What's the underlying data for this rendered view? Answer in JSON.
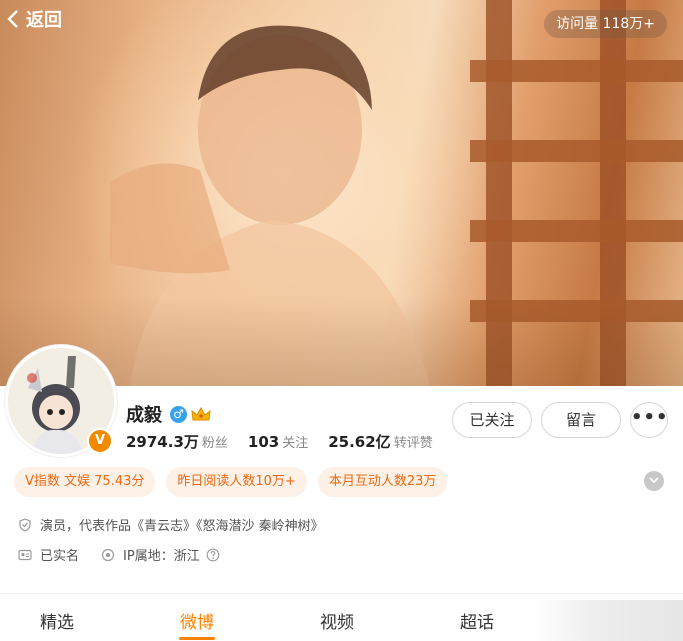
{
  "header": {
    "back_label": "返回",
    "visits": "访问量 118万+"
  },
  "profile": {
    "name": "成毅",
    "gender_symbol": "♂",
    "v_badge": "V",
    "stats": [
      {
        "value": "2974.3万",
        "label": "粉丝"
      },
      {
        "value": "103",
        "label": "关注"
      },
      {
        "value": "25.62亿",
        "label": "转评赞"
      }
    ]
  },
  "actions": {
    "follow_label": "已关注",
    "message_label": "留言",
    "more_label": "•••"
  },
  "tags": [
    "V指数 文娱 75.43分",
    "昨日阅读人数10万+",
    "本月互动人数23万"
  ],
  "info": {
    "bio": "演员，代表作品《青云志》《怒海潜沙 秦岭神树》",
    "verified": "已实名",
    "ip": "IP属地：浙江"
  },
  "tabs": [
    "精选",
    "微博",
    "视频",
    "超话"
  ],
  "colors": {
    "accent": "#ff8200",
    "tag_text": "#e86a12",
    "tag_bg": "#fdf0e6"
  }
}
